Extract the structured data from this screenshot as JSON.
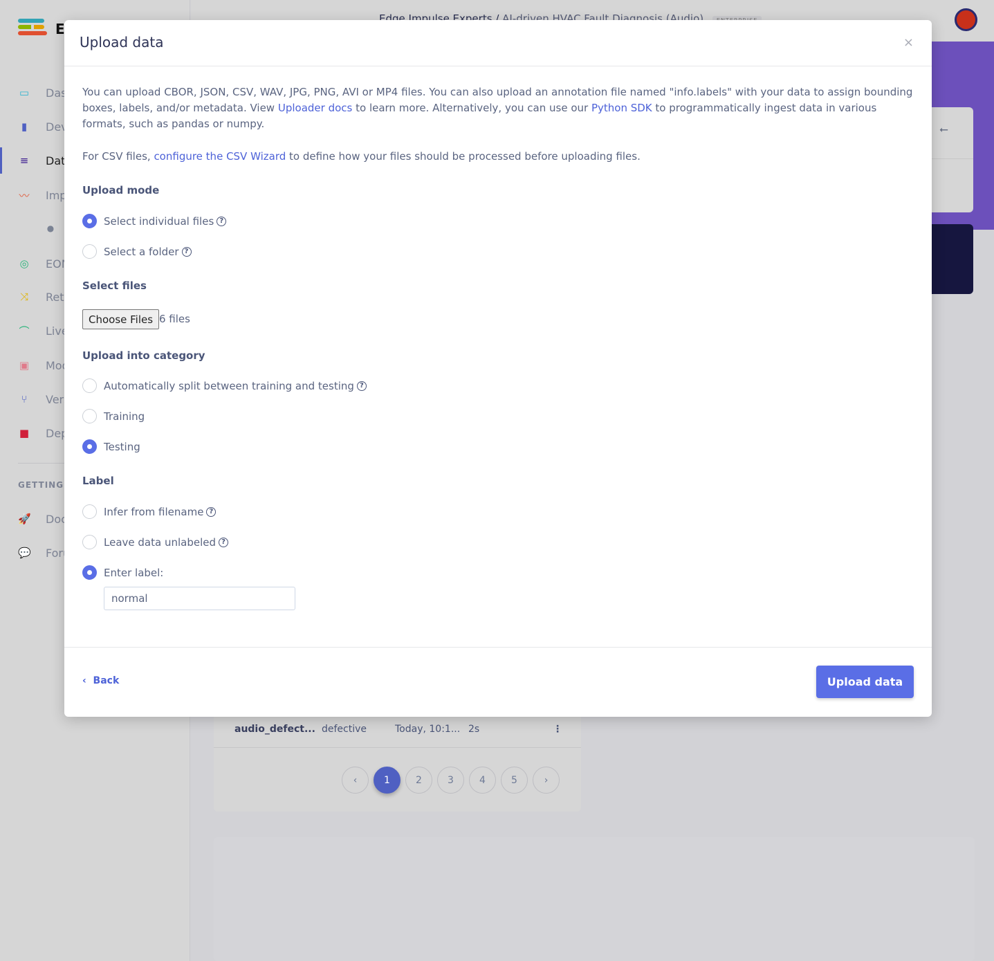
{
  "app": {
    "logo_text": "E",
    "breadcrumb_org": "Edge Impulse Experts",
    "breadcrumb_sep": "/",
    "breadcrumb_project": "AI-driven HVAC Fault Diagnosis (Audio)",
    "badge": "ENTERPRISE"
  },
  "sidebar": {
    "items": [
      {
        "label": "Das",
        "icon": "monitor-icon",
        "color": "#33b5d0"
      },
      {
        "label": "Dev",
        "icon": "chip-icon",
        "color": "#4f60c2"
      },
      {
        "label": "Dat",
        "icon": "database-icon",
        "color": "#3b1b8f"
      },
      {
        "label": "Imp",
        "icon": "pulse-icon",
        "color": "#e05a3a"
      },
      {
        "label": "",
        "icon": "dot-icon",
        "color": "#7b8394"
      },
      {
        "label": "EON",
        "icon": "compass-icon",
        "color": "#2ab47a"
      },
      {
        "label": "Retr",
        "icon": "shuffle-icon",
        "color": "#e0b400"
      },
      {
        "label": "Live",
        "icon": "bezier-icon",
        "color": "#2ab47a"
      },
      {
        "label": "Mod",
        "icon": "clipboard-check-icon",
        "color": "#e07a8a"
      },
      {
        "label": "Vers",
        "icon": "git-branch-icon",
        "color": "#4f60c2"
      },
      {
        "label": "Dep",
        "icon": "cube-icon",
        "color": "#d0203a"
      }
    ],
    "section": "GETTING S",
    "bottom": [
      {
        "label": "Doc",
        "icon": "rocket-icon"
      },
      {
        "label": "Foru",
        "icon": "chat-icon"
      }
    ]
  },
  "table": {
    "row": {
      "name": "audio_defect...",
      "label": "defective",
      "added": "Today, 10:1...",
      "length": "2s"
    },
    "pages": [
      "1",
      "2",
      "3",
      "4",
      "5"
    ],
    "current_page": "1"
  },
  "modal": {
    "title": "Upload data",
    "close": "×",
    "intro1": "You can upload CBOR, JSON, CSV, WAV, JPG, PNG, AVI or MP4 files. You can also upload an annotation file named \"info.labels\" with your data to assign bounding boxes, labels, and/or metadata. View ",
    "uploader_docs": "Uploader docs",
    "intro2": " to learn more. Alternatively, you can use our ",
    "python_sdk": "Python SDK",
    "intro3": " to programmatically ingest data in various formats, such as pandas or numpy.",
    "csv1": "For CSV files, ",
    "csv_link": "configure the CSV Wizard",
    "csv2": " to define how your files should be processed before uploading files.",
    "upload_mode": {
      "title": "Upload mode",
      "options": [
        "Select individual files",
        "Select a folder"
      ],
      "selected": "Select individual files"
    },
    "select_files": {
      "title": "Select files",
      "button": "Choose Files",
      "status": "6 files"
    },
    "category": {
      "title": "Upload into category",
      "options": [
        "Automatically split between training and testing",
        "Training",
        "Testing"
      ],
      "selected": "Testing"
    },
    "label": {
      "title": "Label",
      "options": [
        "Infer from filename",
        "Leave data unlabeled",
        "Enter label:"
      ],
      "selected": "Enter label:",
      "value": "normal"
    },
    "back": "Back",
    "submit": "Upload data",
    "accent": "#5a6ee6"
  }
}
